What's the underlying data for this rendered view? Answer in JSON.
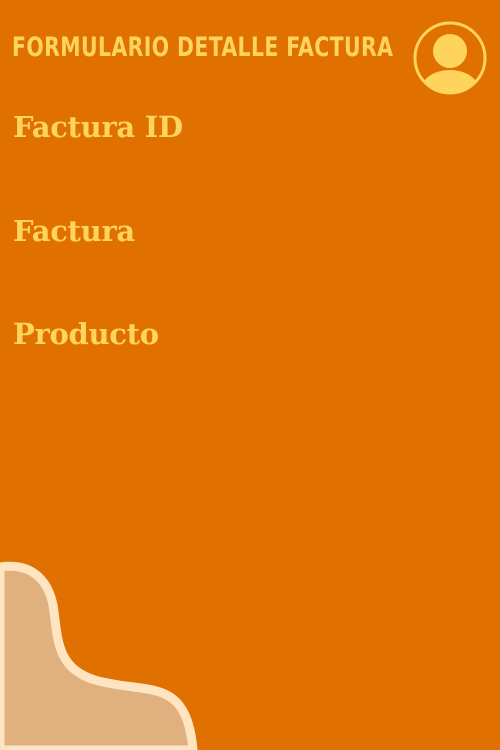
{
  "header": {
    "title": "Formulario Detalle Factura",
    "avatar_icon": "user-avatar-icon"
  },
  "form": {
    "fields": [
      {
        "label": "Factura ID"
      },
      {
        "label": "Factura"
      },
      {
        "label": "Producto"
      }
    ]
  },
  "colors": {
    "background": "#E07000",
    "accent": "#FFD45C",
    "decoration_fill": "#E1B07F",
    "decoration_stroke": "#FFE4C2"
  }
}
